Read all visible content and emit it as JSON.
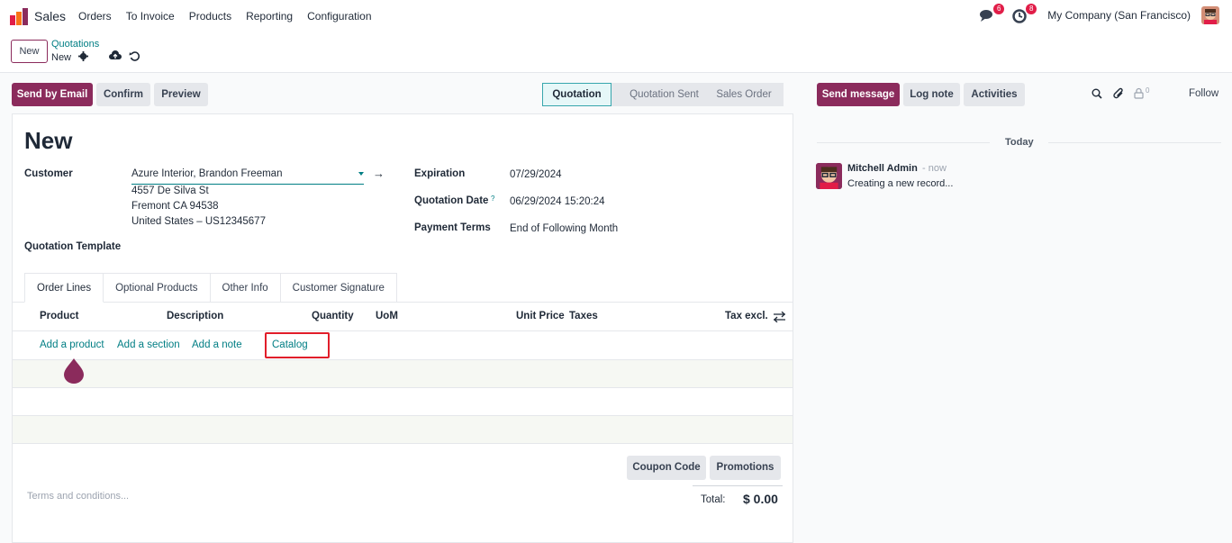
{
  "nav": {
    "app_name": "Sales",
    "menu": [
      "Orders",
      "To Invoice",
      "Products",
      "Reporting",
      "Configuration"
    ],
    "messages_count": "6",
    "activities_count": "8",
    "company": "My Company (San Francisco)"
  },
  "breadcrumb": {
    "new_button": "New",
    "parent": "Quotations",
    "current": "New"
  },
  "actions": {
    "send_email": "Send by Email",
    "confirm": "Confirm",
    "preview": "Preview"
  },
  "status": {
    "current": "Quotation",
    "steps": [
      "Quotation Sent",
      "Sales Order"
    ]
  },
  "form": {
    "title": "New",
    "customer_label": "Customer",
    "customer_value": "Azure Interior, Brandon Freeman",
    "address_line1": "4557 De Silva St",
    "address_line2": "Fremont CA 94538",
    "address_line3": "United States – US12345677",
    "template_label": "Quotation Template",
    "expiration_label": "Expiration",
    "expiration_value": "07/29/2024",
    "quotation_date_label": "Quotation Date",
    "quotation_date_help": "?",
    "quotation_date_value": "06/29/2024 15:20:24",
    "payment_terms_label": "Payment Terms",
    "payment_terms_value": "End of Following Month"
  },
  "tabs": [
    "Order Lines",
    "Optional Products",
    "Other Info",
    "Customer Signature"
  ],
  "table": {
    "headers": {
      "product": "Product",
      "description": "Description",
      "quantity": "Quantity",
      "uom": "UoM",
      "unit_price": "Unit Price",
      "taxes": "Taxes",
      "tax_excl": "Tax excl."
    },
    "links": {
      "add_product": "Add a product",
      "add_section": "Add a section",
      "add_note": "Add a note",
      "catalog": "Catalog"
    }
  },
  "footer": {
    "coupon_code": "Coupon Code",
    "promotions": "Promotions",
    "terms_placeholder": "Terms and conditions...",
    "total_label": "Total:",
    "total_value": "$ 0.00"
  },
  "chatter": {
    "send_message": "Send message",
    "log_note": "Log note",
    "activities": "Activities",
    "followers_count": "0",
    "follow": "Follow",
    "today": "Today",
    "message_author": "Mitchell Admin",
    "message_time": "- now",
    "message_body": "Creating a new record..."
  },
  "colors": {
    "brand": "#8b2b5c",
    "link": "#017e84",
    "highlight_box": "#e11d2a"
  }
}
